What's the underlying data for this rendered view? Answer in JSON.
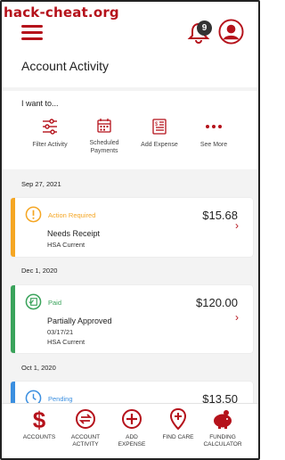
{
  "watermark": "hack-cheat.org",
  "header": {
    "title": "Account Activity",
    "notification_count": "9"
  },
  "iwant": {
    "label": "I want to...",
    "items": [
      {
        "label": "Filter Activity",
        "icon": "sliders-icon"
      },
      {
        "label": "Scheduled\nPayments",
        "icon": "calendar-icon"
      },
      {
        "label": "Add Expense",
        "icon": "receipt-icon"
      },
      {
        "label": "See More",
        "icon": "more-dots-icon"
      }
    ]
  },
  "groups": [
    {
      "date": "Sep 27, 2021",
      "card": {
        "status": "Action Required",
        "status_color": "#f5a623",
        "amount": "$15.68",
        "title": "Needs Receipt",
        "sub1": "HSA Current",
        "sub2": ""
      }
    },
    {
      "date": "Dec 1, 2020",
      "card": {
        "status": "Paid",
        "status_color": "#3aa35b",
        "amount": "$120.00",
        "title": "Partially Approved",
        "sub1": "03/17/21",
        "sub2": "HSA Current"
      }
    },
    {
      "date": "Oct 1, 2020",
      "card": {
        "status": "Pending",
        "status_color": "#3b8fe0",
        "amount": "$13.50",
        "title": "",
        "sub1": "",
        "sub2": ""
      }
    }
  ],
  "bottom_nav": [
    {
      "label": "Accounts",
      "icon": "dollar-icon"
    },
    {
      "label": "Account\nActivity",
      "icon": "transfer-icon"
    },
    {
      "label": "Add\nExpense",
      "icon": "plus-circle-icon"
    },
    {
      "label": "Find Care",
      "icon": "map-pin-icon"
    },
    {
      "label": "Funding\nCalculator",
      "icon": "piggy-bank-icon"
    }
  ],
  "colors": {
    "brand_red": "#b5121b",
    "background": "#f3f3f3"
  }
}
